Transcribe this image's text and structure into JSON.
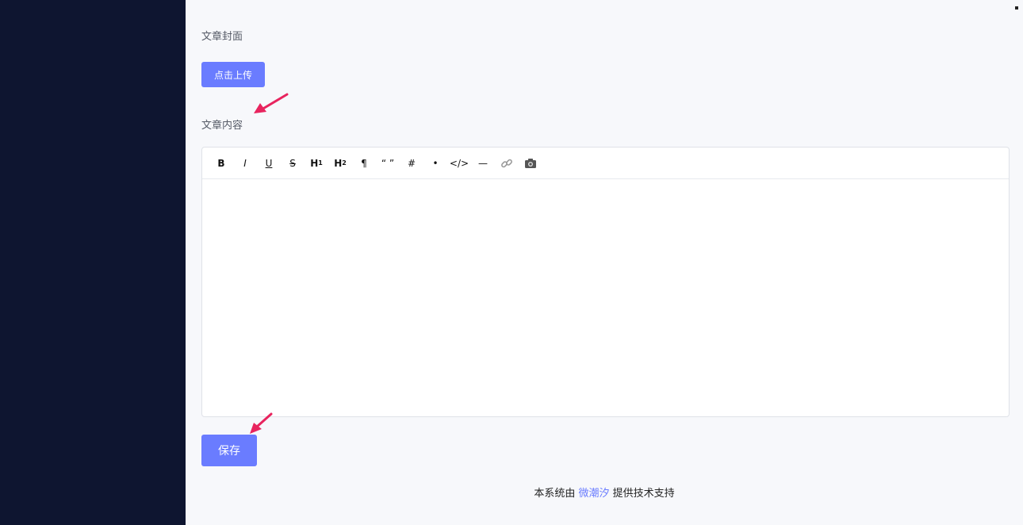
{
  "form": {
    "cover_label": "文章封面",
    "upload_button": "点击上传",
    "content_label": "文章内容",
    "save_button": "保存"
  },
  "toolbar": {
    "bold": "B",
    "italic": "I",
    "underline": "U",
    "strikethrough": "S",
    "heading1": "H",
    "heading1_sub": "1",
    "heading2": "H",
    "heading2_sub": "2",
    "paragraph": "¶",
    "quote": "“ ”",
    "code_inline": "#",
    "list": "•",
    "code_block": "</>",
    "divider": "—",
    "link_icon": "link-icon",
    "image_icon": "camera-icon"
  },
  "footer": {
    "prefix": "本系统由",
    "brand": "微潮汐",
    "suffix": "提供技术支持"
  },
  "colors": {
    "sidebar": "#0e1530",
    "accent": "#6a7cff",
    "annotation_arrow": "#e8245e"
  }
}
